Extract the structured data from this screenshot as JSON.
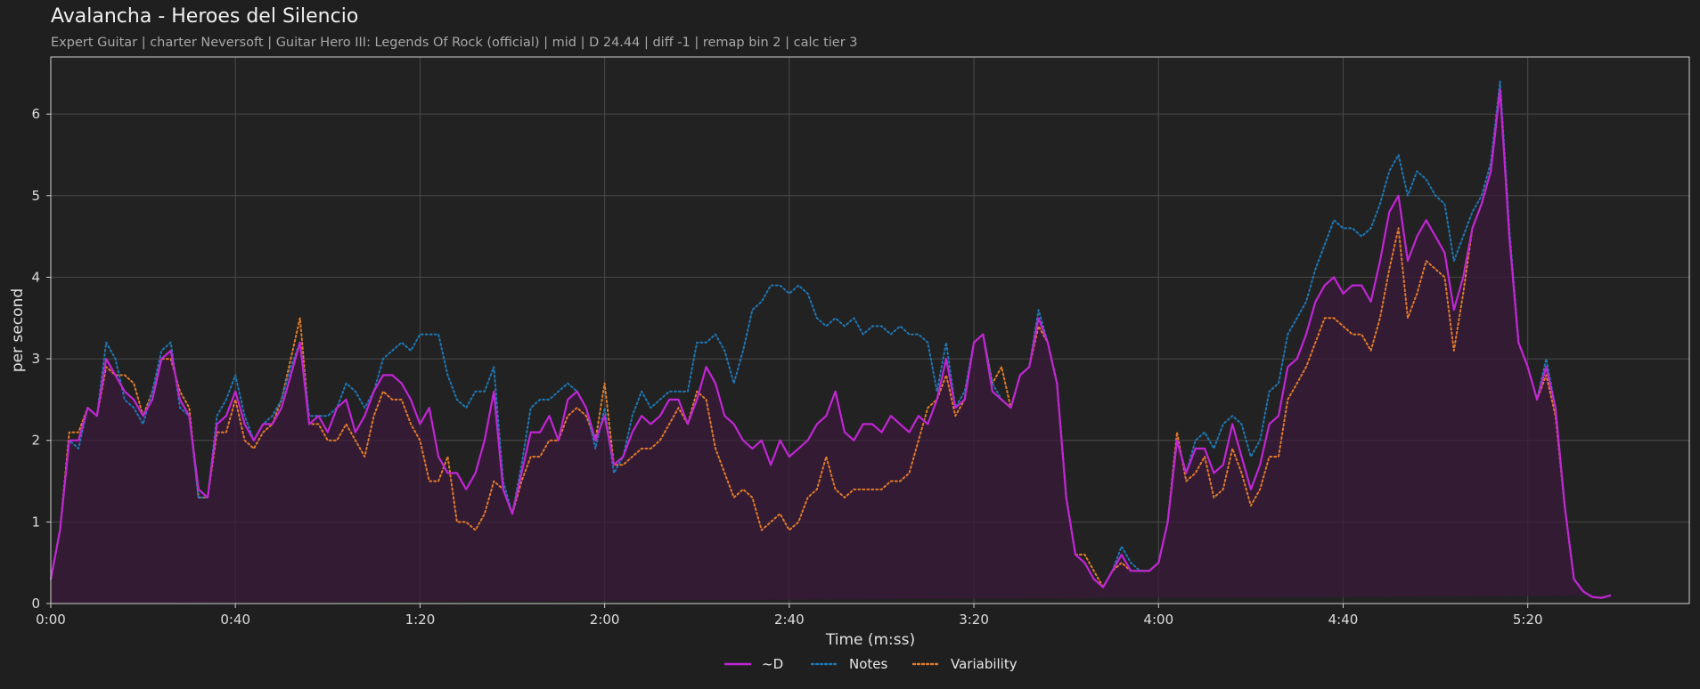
{
  "header": {
    "title": "Avalancha - Heroes del Silencio",
    "subtitle": "Expert Guitar  |  charter Neversoft  |  Guitar Hero III: Legends Of Rock (official)  |  mid  |  D 24.44  |  diff -1  |  remap bin 2  |  calc tier 3"
  },
  "chart_data": {
    "type": "line",
    "title": "Avalancha - Heroes del Silencio",
    "xlabel": "Time (m:ss)",
    "ylabel": "per second",
    "xlim": [
      0,
      355
    ],
    "ylim": [
      0,
      6.7
    ],
    "grid": true,
    "legend_position": "bottom-center",
    "x_ticks": [
      {
        "value": 0,
        "label": "0:00"
      },
      {
        "value": 40,
        "label": "0:40"
      },
      {
        "value": 80,
        "label": "1:20"
      },
      {
        "value": 120,
        "label": "2:00"
      },
      {
        "value": 160,
        "label": "2:40"
      },
      {
        "value": 200,
        "label": "3:20"
      },
      {
        "value": 240,
        "label": "4:00"
      },
      {
        "value": 280,
        "label": "4:40"
      },
      {
        "value": 320,
        "label": "5:20"
      }
    ],
    "y_ticks": [
      0,
      1,
      2,
      3,
      4,
      5,
      6
    ],
    "x": [
      0,
      2,
      4,
      6,
      8,
      10,
      12,
      14,
      16,
      18,
      20,
      22,
      24,
      26,
      28,
      30,
      32,
      34,
      36,
      38,
      40,
      42,
      44,
      46,
      48,
      50,
      52,
      54,
      56,
      58,
      60,
      62,
      64,
      66,
      68,
      70,
      72,
      74,
      76,
      78,
      80,
      82,
      84,
      86,
      88,
      90,
      92,
      94,
      96,
      98,
      100,
      102,
      104,
      106,
      108,
      110,
      112,
      114,
      116,
      118,
      120,
      122,
      124,
      126,
      128,
      130,
      132,
      134,
      136,
      138,
      140,
      142,
      144,
      146,
      148,
      150,
      152,
      154,
      156,
      158,
      160,
      162,
      164,
      166,
      168,
      170,
      172,
      174,
      176,
      178,
      180,
      182,
      184,
      186,
      188,
      190,
      192,
      194,
      196,
      198,
      200,
      202,
      204,
      206,
      208,
      210,
      212,
      214,
      216,
      218,
      220,
      222,
      224,
      226,
      228,
      230,
      232,
      234,
      236,
      238,
      240,
      242,
      244,
      246,
      248,
      250,
      252,
      254,
      256,
      258,
      260,
      262,
      264,
      266,
      268,
      270,
      272,
      274,
      276,
      278,
      280,
      282,
      284,
      286,
      288,
      290,
      292,
      294,
      296,
      298,
      300,
      302,
      304,
      306,
      308,
      310,
      312,
      314,
      316,
      318,
      320,
      322,
      324,
      326,
      328,
      330,
      332,
      334,
      336,
      338,
      340,
      342,
      344,
      346,
      348,
      350,
      352,
      354,
      355
    ],
    "series": [
      {
        "name": "~D",
        "color": "#c026d3",
        "style": "solid",
        "fill": true,
        "values": [
          0.3,
          0.9,
          2.0,
          2.0,
          2.4,
          2.3,
          3.0,
          2.8,
          2.6,
          2.5,
          2.3,
          2.5,
          3.0,
          3.1,
          2.5,
          2.3,
          1.4,
          1.3,
          2.2,
          2.3,
          2.6,
          2.2,
          2.0,
          2.2,
          2.2,
          2.4,
          2.8,
          3.2,
          2.2,
          2.3,
          2.1,
          2.4,
          2.5,
          2.1,
          2.3,
          2.6,
          2.8,
          2.8,
          2.7,
          2.5,
          2.2,
          2.4,
          1.8,
          1.6,
          1.6,
          1.4,
          1.6,
          2.0,
          2.6,
          1.4,
          1.1,
          1.6,
          2.1,
          2.1,
          2.3,
          2.0,
          2.5,
          2.6,
          2.4,
          2.0,
          2.3,
          1.7,
          1.8,
          2.1,
          2.3,
          2.2,
          2.3,
          2.5,
          2.5,
          2.2,
          2.5,
          2.9,
          2.7,
          2.3,
          2.2,
          2.0,
          1.9,
          2.0,
          1.7,
          2.0,
          1.8,
          1.9,
          2.0,
          2.2,
          2.3,
          2.6,
          2.1,
          2.0,
          2.2,
          2.2,
          2.1,
          2.3,
          2.2,
          2.1,
          2.3,
          2.2,
          2.5,
          3.0,
          2.4,
          2.5,
          3.2,
          3.3,
          2.6,
          2.5,
          2.4,
          2.8,
          2.9,
          3.5,
          3.2,
          2.7,
          1.3,
          0.6,
          0.5,
          0.3,
          0.2,
          0.4,
          0.6,
          0.4,
          0.4,
          0.4,
          0.5,
          1.0,
          2.0,
          1.6,
          1.9,
          1.9,
          1.6,
          1.7,
          2.2,
          1.8,
          1.4,
          1.7,
          2.2,
          2.3,
          2.9,
          3.0,
          3.3,
          3.7,
          3.9,
          4.0,
          3.8,
          3.9,
          3.9,
          3.7,
          4.2,
          4.8,
          5.0,
          4.2,
          4.5,
          4.7,
          4.5,
          4.3,
          3.6,
          4.0,
          4.6,
          4.9,
          5.3,
          6.3,
          4.5,
          3.2,
          2.9,
          2.5,
          2.9,
          2.4,
          1.2,
          0.3,
          0.15,
          0.08,
          0.07,
          0.1
        ]
      },
      {
        "name": "Notes",
        "color": "#1f77b4",
        "style": "dotted",
        "fill": false,
        "values": [
          0.3,
          0.9,
          2.0,
          1.9,
          2.4,
          2.3,
          3.2,
          3.0,
          2.5,
          2.4,
          2.2,
          2.6,
          3.1,
          3.2,
          2.4,
          2.3,
          1.3,
          1.3,
          2.3,
          2.5,
          2.8,
          2.3,
          2.0,
          2.2,
          2.3,
          2.5,
          2.9,
          3.2,
          2.3,
          2.3,
          2.3,
          2.4,
          2.7,
          2.6,
          2.4,
          2.6,
          3.0,
          3.1,
          3.2,
          3.1,
          3.3,
          3.3,
          3.3,
          2.8,
          2.5,
          2.4,
          2.6,
          2.6,
          2.9,
          1.5,
          1.1,
          1.7,
          2.4,
          2.5,
          2.5,
          2.6,
          2.7,
          2.6,
          2.4,
          1.9,
          2.4,
          1.6,
          1.8,
          2.3,
          2.6,
          2.4,
          2.5,
          2.6,
          2.6,
          2.6,
          3.2,
          3.2,
          3.3,
          3.1,
          2.7,
          3.1,
          3.6,
          3.7,
          3.9,
          3.9,
          3.8,
          3.9,
          3.8,
          3.5,
          3.4,
          3.5,
          3.4,
          3.5,
          3.3,
          3.4,
          3.4,
          3.3,
          3.4,
          3.3,
          3.3,
          3.2,
          2.6,
          3.2,
          2.4,
          2.6,
          3.2,
          3.3,
          2.7,
          2.5,
          2.4,
          2.8,
          2.9,
          3.6,
          3.2,
          2.7,
          1.3,
          0.6,
          0.5,
          0.3,
          0.2,
          0.4,
          0.7,
          0.5,
          0.4,
          0.4,
          0.5,
          1.0,
          2.0,
          1.6,
          2.0,
          2.1,
          1.9,
          2.2,
          2.3,
          2.2,
          1.8,
          2.0,
          2.6,
          2.7,
          3.3,
          3.5,
          3.7,
          4.1,
          4.4,
          4.7,
          4.6,
          4.6,
          4.5,
          4.6,
          4.9,
          5.3,
          5.5,
          5.0,
          5.3,
          5.2,
          5.0,
          4.9,
          4.2,
          4.5,
          4.8,
          5.0,
          5.4,
          6.4,
          4.6,
          3.2,
          2.9,
          2.5,
          3.0,
          2.4,
          1.2,
          0.3,
          0.15,
          0.08,
          0.07,
          0.1
        ]
      },
      {
        "name": "Variability",
        "color": "#e07b2a",
        "style": "dotted",
        "fill": false,
        "values": [
          0.3,
          0.9,
          2.1,
          2.1,
          2.4,
          2.3,
          2.9,
          2.8,
          2.8,
          2.7,
          2.3,
          2.6,
          3.0,
          3.0,
          2.6,
          2.4,
          1.3,
          1.3,
          2.1,
          2.1,
          2.5,
          2.0,
          1.9,
          2.1,
          2.2,
          2.5,
          3.0,
          3.5,
          2.2,
          2.2,
          2.0,
          2.0,
          2.2,
          2.0,
          1.8,
          2.3,
          2.6,
          2.5,
          2.5,
          2.2,
          2.0,
          1.5,
          1.5,
          1.8,
          1.0,
          1.0,
          0.9,
          1.1,
          1.5,
          1.4,
          1.1,
          1.5,
          1.8,
          1.8,
          2.0,
          2.0,
          2.3,
          2.4,
          2.3,
          2.0,
          2.7,
          1.7,
          1.7,
          1.8,
          1.9,
          1.9,
          2.0,
          2.2,
          2.4,
          2.2,
          2.6,
          2.5,
          1.9,
          1.6,
          1.3,
          1.4,
          1.3,
          0.9,
          1.0,
          1.1,
          0.9,
          1.0,
          1.3,
          1.4,
          1.8,
          1.4,
          1.3,
          1.4,
          1.4,
          1.4,
          1.4,
          1.5,
          1.5,
          1.6,
          2.0,
          2.4,
          2.5,
          2.8,
          2.3,
          2.5,
          3.2,
          3.3,
          2.7,
          2.9,
          2.4,
          2.8,
          2.9,
          3.4,
          3.2,
          2.7,
          1.3,
          0.6,
          0.6,
          0.4,
          0.2,
          0.4,
          0.5,
          0.4,
          0.4,
          0.4,
          0.5,
          1.0,
          2.1,
          1.5,
          1.6,
          1.8,
          1.3,
          1.4,
          1.9,
          1.6,
          1.2,
          1.4,
          1.8,
          1.8,
          2.5,
          2.7,
          2.9,
          3.2,
          3.5,
          3.5,
          3.4,
          3.3,
          3.3,
          3.1,
          3.5,
          4.1,
          4.6,
          3.5,
          3.8,
          4.2,
          4.1,
          4.0,
          3.1,
          3.8,
          4.6,
          4.9,
          5.3,
          6.3,
          4.5,
          3.2,
          2.9,
          2.5,
          2.8,
          2.3,
          1.2,
          0.3,
          0.15,
          0.08,
          0.07,
          0.1
        ]
      }
    ]
  }
}
